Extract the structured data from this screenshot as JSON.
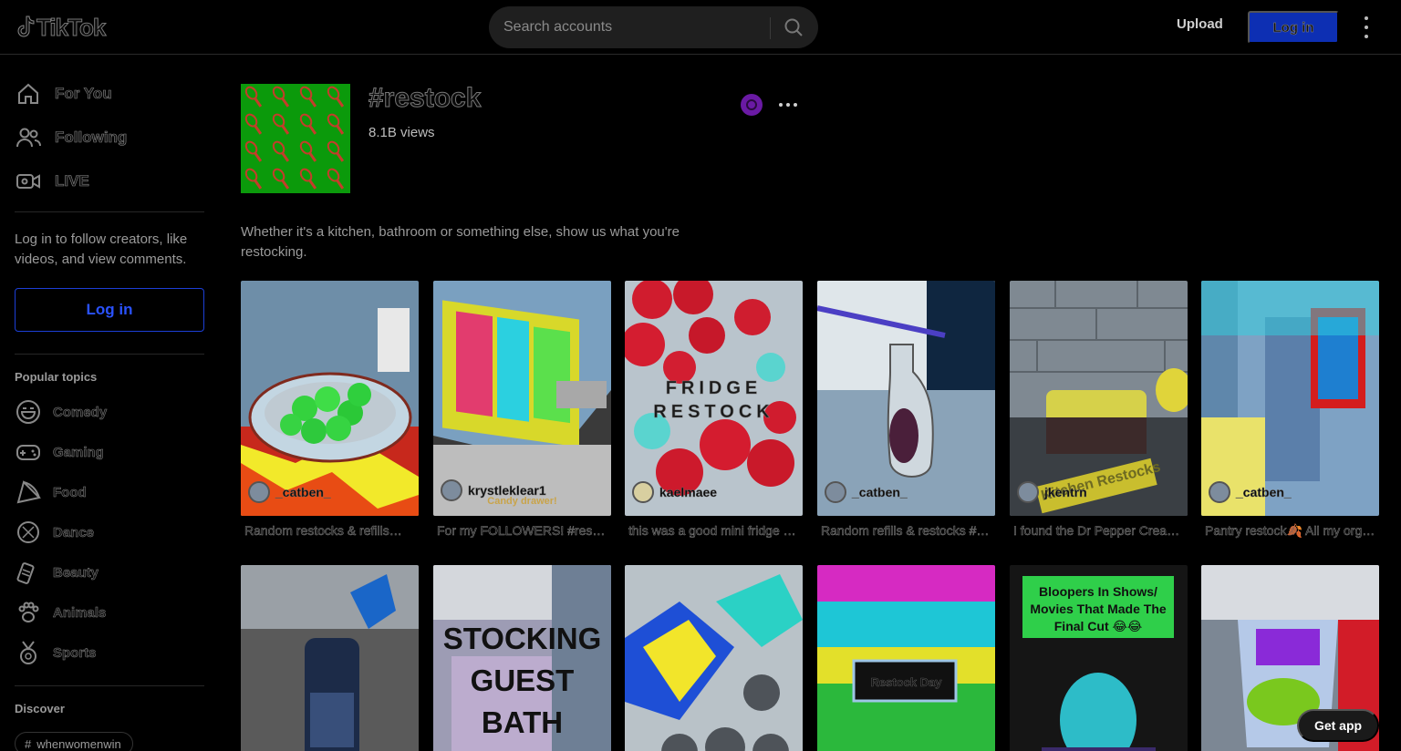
{
  "header": {
    "logo_text": "TikTok",
    "search_placeholder": "Search accounts",
    "upload_label": "Upload",
    "login_label": "Log in"
  },
  "sidebar": {
    "nav": [
      {
        "label": "For You",
        "icon": "home-icon"
      },
      {
        "label": "Following",
        "icon": "people-icon"
      },
      {
        "label": "LIVE",
        "icon": "live-icon"
      }
    ],
    "login_prompt": "Log in to follow creators, like videos, and view comments.",
    "login_button": "Log in",
    "popular_topics_title": "Popular topics",
    "topics": [
      {
        "label": "Comedy",
        "icon": "comedy-icon"
      },
      {
        "label": "Gaming",
        "icon": "gaming-icon"
      },
      {
        "label": "Food",
        "icon": "food-icon"
      },
      {
        "label": "Dance",
        "icon": "dance-icon"
      },
      {
        "label": "Beauty",
        "icon": "beauty-icon"
      },
      {
        "label": "Animals",
        "icon": "animals-icon"
      },
      {
        "label": "Sports",
        "icon": "sports-icon"
      }
    ],
    "discover_title": "Discover",
    "discover_chip": "whenwomenwin"
  },
  "hashtag": {
    "title": "#restock",
    "views": "8.1B views",
    "description": "Whether it's a kitchen, bathroom or something else, show us what you're restocking."
  },
  "videos": [
    {
      "user": "_catben_",
      "caption": "Random restocks & refills✨ #restock #organ..."
    },
    {
      "user": "krystleklear1",
      "caption": "For my FOLLOWERS! #restock #asmr #satisf...",
      "overlay_text": "Candy drawer!"
    },
    {
      "user": "kaelmaee",
      "caption": "this was a good mini fridge restock #restock",
      "overlay_text": "FRIDGE RESTOCK"
    },
    {
      "user": "_catben_",
      "caption": "Random refills & restocks #restock #refill"
    },
    {
      "user": "jkentrn",
      "caption": "I found the Dr Pepper Cream Soda #restock",
      "overlay_text": "Kitchen Restocks"
    },
    {
      "user": "_catben_",
      "caption": "Pantry restock🍂 All my organizers are linked"
    },
    {
      "user": "",
      "caption": ""
    },
    {
      "user": "",
      "caption": "",
      "overlay_text": "STOCKING GUEST BATH"
    },
    {
      "user": "",
      "caption": ""
    },
    {
      "user": "",
      "caption": "",
      "overlay_text": "Restock Day"
    },
    {
      "user": "",
      "caption": "",
      "overlay_text": "Bloopers In Shows/ Movies That Made The Final Cut 😂😂"
    },
    {
      "user": "",
      "caption": ""
    }
  ],
  "get_app_label": "Get app"
}
